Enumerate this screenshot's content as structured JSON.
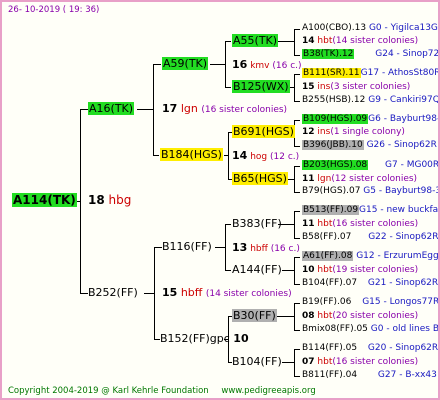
{
  "header": {
    "date": "26- 10-2019 ( 19: 36)"
  },
  "root": {
    "id": "A114(TK)",
    "year": "18",
    "code": "hbg"
  },
  "gen1": [
    {
      "id": "A16(TK)",
      "year": "17",
      "code": "lgn",
      "note": "(16 sister colonies)"
    },
    {
      "id": "B252(FF)",
      "year": "15",
      "code": "hbff",
      "note": "(14 sister colonies)"
    }
  ],
  "gen2": [
    {
      "id": "A59(TK)",
      "year": "16",
      "code": "kmv",
      "note": "(16 c.)"
    },
    {
      "id": "B184(HGS)",
      "year": "14",
      "code": "hog",
      "note": "(12 c.)"
    },
    {
      "id": "B116(FF)",
      "year": "13",
      "code": "hbff",
      "note": "(16 c.)"
    },
    {
      "id": "B152(FF)gpc",
      "year": "10",
      "code": "",
      "note": ""
    }
  ],
  "gen3": [
    {
      "id": "A55(TK)",
      "year": "14",
      "code": "hbt",
      "note": "(14 sister colonies)"
    },
    {
      "id": "B125(WX)",
      "year": "15",
      "code": "ins",
      "note": "(3 sister colonies)"
    },
    {
      "id": "B691(HGS)",
      "year": "12",
      "code": "ins",
      "note": "(1 single colony)"
    },
    {
      "id": "B65(HGS)",
      "year": "11",
      "code": "lgn",
      "note": "(12 sister colonies)"
    },
    {
      "id": "B383(FF)",
      "year": "11",
      "code": "hbt",
      "note": "(16 sister colonies)"
    },
    {
      "id": "A144(FF)",
      "year": "10",
      "code": "hbt",
      "note": "(19 sister colonies)"
    },
    {
      "id": "B30(FF)",
      "year": "08",
      "code": "hbt",
      "note": "(20 sister colonies)"
    },
    {
      "id": "B104(FF)",
      "year": "07",
      "code": "hbt",
      "note": "(16 sister colonies)"
    }
  ],
  "gen4": [
    {
      "id": "A100(CBO).13",
      "ref": "G0 - Yigilca13G"
    },
    {
      "id": "B38(TK).12",
      "ref": "G24 - Sinop72R"
    },
    {
      "id": "B111(SR).11",
      "ref": "G17 - AthosSt80R"
    },
    {
      "id": "B255(HSB).12",
      "ref": "G9 - Cankiri97Q"
    },
    {
      "id": "B109(HGS).09",
      "ref": "G6 - Bayburt98-3"
    },
    {
      "id": "B396(JBB).10",
      "ref": "G26 - Sinop62R"
    },
    {
      "id": "B203(HGS).08",
      "ref": "G7 - MG00R"
    },
    {
      "id": "B79(HGS).07",
      "ref": "G5 - Bayburt98-3"
    },
    {
      "id": "B513(FF).09",
      "ref": "G15 - new buckfas"
    },
    {
      "id": "B58(FF).07",
      "ref": "G22 - Sinop62R"
    },
    {
      "id": "A61(FF).08",
      "ref": "G12 - ErzurumEgg8"
    },
    {
      "id": "B104(FF).07",
      "ref": "G21 - Sinop62R"
    },
    {
      "id": "B19(FF).06",
      "ref": "G15 - Longos77R"
    },
    {
      "id": "Bmix08(FF).05",
      "ref": "G0 - old lines B"
    },
    {
      "id": "B114(FF).05",
      "ref": "G20 - Sinop62R"
    },
    {
      "id": "B811(FF).04",
      "ref": "G27 - B-xx43"
    }
  ],
  "footer": {
    "copyright": "Copyright 2004-2019 @ Karl Kehrle Foundation",
    "site": "www.pedigreeapis.org"
  },
  "colors": {
    "highlight_green": "#22dd22",
    "highlight_yellow": "#ffee00",
    "highlight_gray": "#b0b0b0",
    "border_pink": "#e8a0c8",
    "code_red": "#cc0000",
    "note_purple": "#8800aa",
    "ref_blue": "#1818c0"
  }
}
